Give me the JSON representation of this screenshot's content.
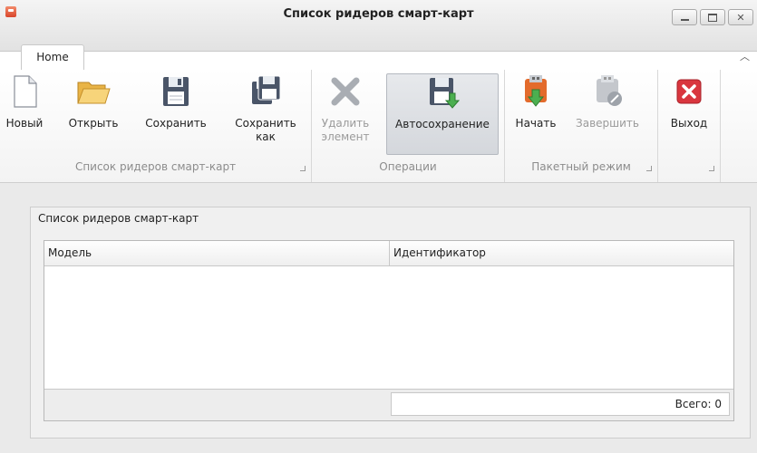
{
  "window": {
    "title": "Список ридеров смарт-карт"
  },
  "tabs": [
    {
      "label": "Home"
    }
  ],
  "ribbon": {
    "groups": [
      {
        "label": "Список ридеров смарт-карт",
        "buttons": [
          {
            "label": "Новый",
            "icon": "new-document-icon"
          },
          {
            "label": "Открыть",
            "icon": "open-folder-icon"
          },
          {
            "label": "Сохранить",
            "icon": "save-icon"
          },
          {
            "label": "Сохранить\nкак",
            "line1": "Сохранить",
            "line2": "как",
            "icon": "save-as-icon"
          }
        ]
      },
      {
        "label": "Операции",
        "buttons": [
          {
            "label": "Удалить элемент",
            "line1": "Удалить",
            "line2": "элемент",
            "icon": "delete-x-icon",
            "enabled": false
          },
          {
            "label": "Автосохранение",
            "icon": "autosave-icon",
            "pressed": true
          }
        ]
      },
      {
        "label": "Пакетный режим",
        "buttons": [
          {
            "label": "Начать",
            "icon": "start-batch-icon"
          },
          {
            "label": "Завершить",
            "icon": "finish-batch-icon",
            "enabled": false
          }
        ]
      },
      {
        "label": "",
        "buttons": [
          {
            "label": "Выход",
            "icon": "exit-icon"
          }
        ]
      }
    ]
  },
  "panel": {
    "title": "Список ридеров смарт-карт",
    "columns": [
      "Модель",
      "Идентификатор"
    ],
    "rows": [],
    "total": "Всего: 0"
  }
}
